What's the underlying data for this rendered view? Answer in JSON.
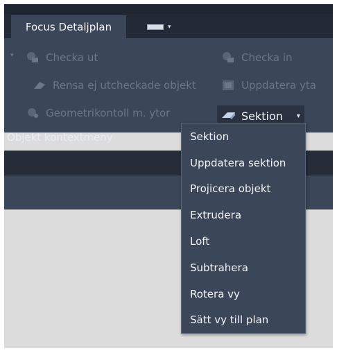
{
  "tabs": {
    "active_label": "Focus Detaljplan",
    "secondary_icon": "window-icon"
  },
  "ribbon": {
    "items": [
      {
        "label": "Checka ut",
        "icon": "check-out-icon"
      },
      {
        "label": "Checka in",
        "icon": "check-in-icon"
      },
      {
        "label": "Rensa ej utcheckade objekt",
        "icon": "eraser-icon"
      },
      {
        "label": "Uppdatera yta",
        "icon": "update-area-icon"
      },
      {
        "label": "Geometrikontoll m. ytor",
        "icon": "geometry-check-icon"
      }
    ],
    "split_button": {
      "label": "Sektion",
      "icon": "section-icon"
    },
    "panel_label": "Objekt kontextmeny"
  },
  "menu": {
    "items": [
      "Sektion",
      "Uppdatera sektion",
      "Projicera objekt",
      "Extrudera",
      "Loft",
      "Subtrahera",
      "Rotera vy",
      "Sätt vy till plan"
    ]
  },
  "colors": {
    "ribbon_bg": "#3b4659",
    "tabbar_bg": "#232a37",
    "disabled_text": "#6b7688",
    "text": "#f2f4f7",
    "canvas_bg": "#dcdcdc"
  }
}
